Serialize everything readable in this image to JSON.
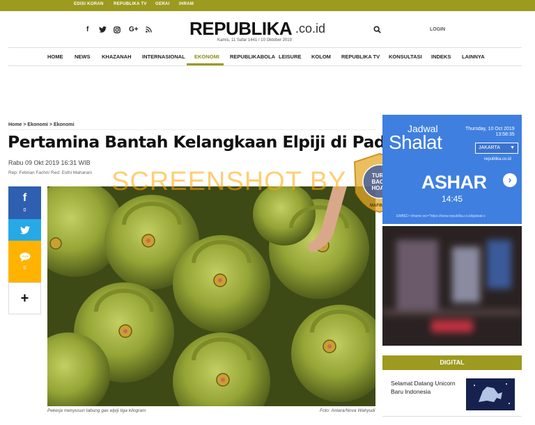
{
  "topbar": {
    "links": [
      "EDISI KORAN",
      "REPUBLIKA TV",
      "GERAI",
      "IHRAM"
    ]
  },
  "header": {
    "social_icons": [
      "facebook-icon",
      "twitter-icon",
      "instagram-icon",
      "google-plus-icon",
      "rss-icon"
    ],
    "social_glyphs": [
      "f",
      "🐦",
      "◎",
      "G+",
      "⟟"
    ],
    "logo_main": "REPUBLIKA",
    "logo_suffix": ".co.id",
    "date_line": "Kamis, 11 Safar 1441 / 10 Oktober 2019",
    "login_label": "LOGIN"
  },
  "nav": {
    "items": [
      "HOME",
      "NEWS",
      "KHAZANAH",
      "INTERNASIONAL",
      "EKONOMI",
      "REPUBLIKABOLA",
      "LEISURE",
      "KOLOM",
      "REPUBLIKA TV",
      "KONSULTASI",
      "INDEKS",
      "LAINNYA"
    ],
    "active": "EKONOMI"
  },
  "article": {
    "breadcrumb": "Home > Ekonomi > Ekonomi",
    "title": "Pertamina Bantah Kelangkaan Elpiji di Padang",
    "published": "Rabu 09 Okt 2019 16:31 WIB",
    "reporter": "Rep: Febrian Fachri/ Red: Esthi Maharani",
    "caption": "Pekerja menyusun tabung gas elpiji tiga kilogram",
    "photo_credit": "Foto: Antara/Nova Wahyudi"
  },
  "share": {
    "facebook_count": "0",
    "comment_count": "0"
  },
  "watermark": {
    "text": "SCREENSHOT BY",
    "stamp_outer": "MASYARAKAT ANTI FITNAH INDONESIA",
    "stamp_inner": [
      "TURN",
      "BACK",
      "HOAX"
    ],
    "stamp_bottom": "MAFINDO"
  },
  "shalat": {
    "heading_small": "Jadwal",
    "heading_large": "Shalat",
    "date": "Thursday, 10 Oct 2019",
    "clock": "13:58:35",
    "city": "JAKARTA",
    "site": "republika.co.id",
    "prayer_name": "ASHAR",
    "prayer_time": "14:45",
    "embed_text": "EMBED <iframe src=\"https://www.republika.co.id/jadwal-s"
  },
  "digital": {
    "heading": "DIGITAL",
    "item_title": "Selamat Datang Unicorn Baru Indonesia"
  },
  "colors": {
    "brand_olive": "#9c9a1f",
    "facebook": "#2f5fb0",
    "twitter": "#27a9e6",
    "comment": "#ffb300",
    "shalat_blue": "#3f7fe0"
  }
}
